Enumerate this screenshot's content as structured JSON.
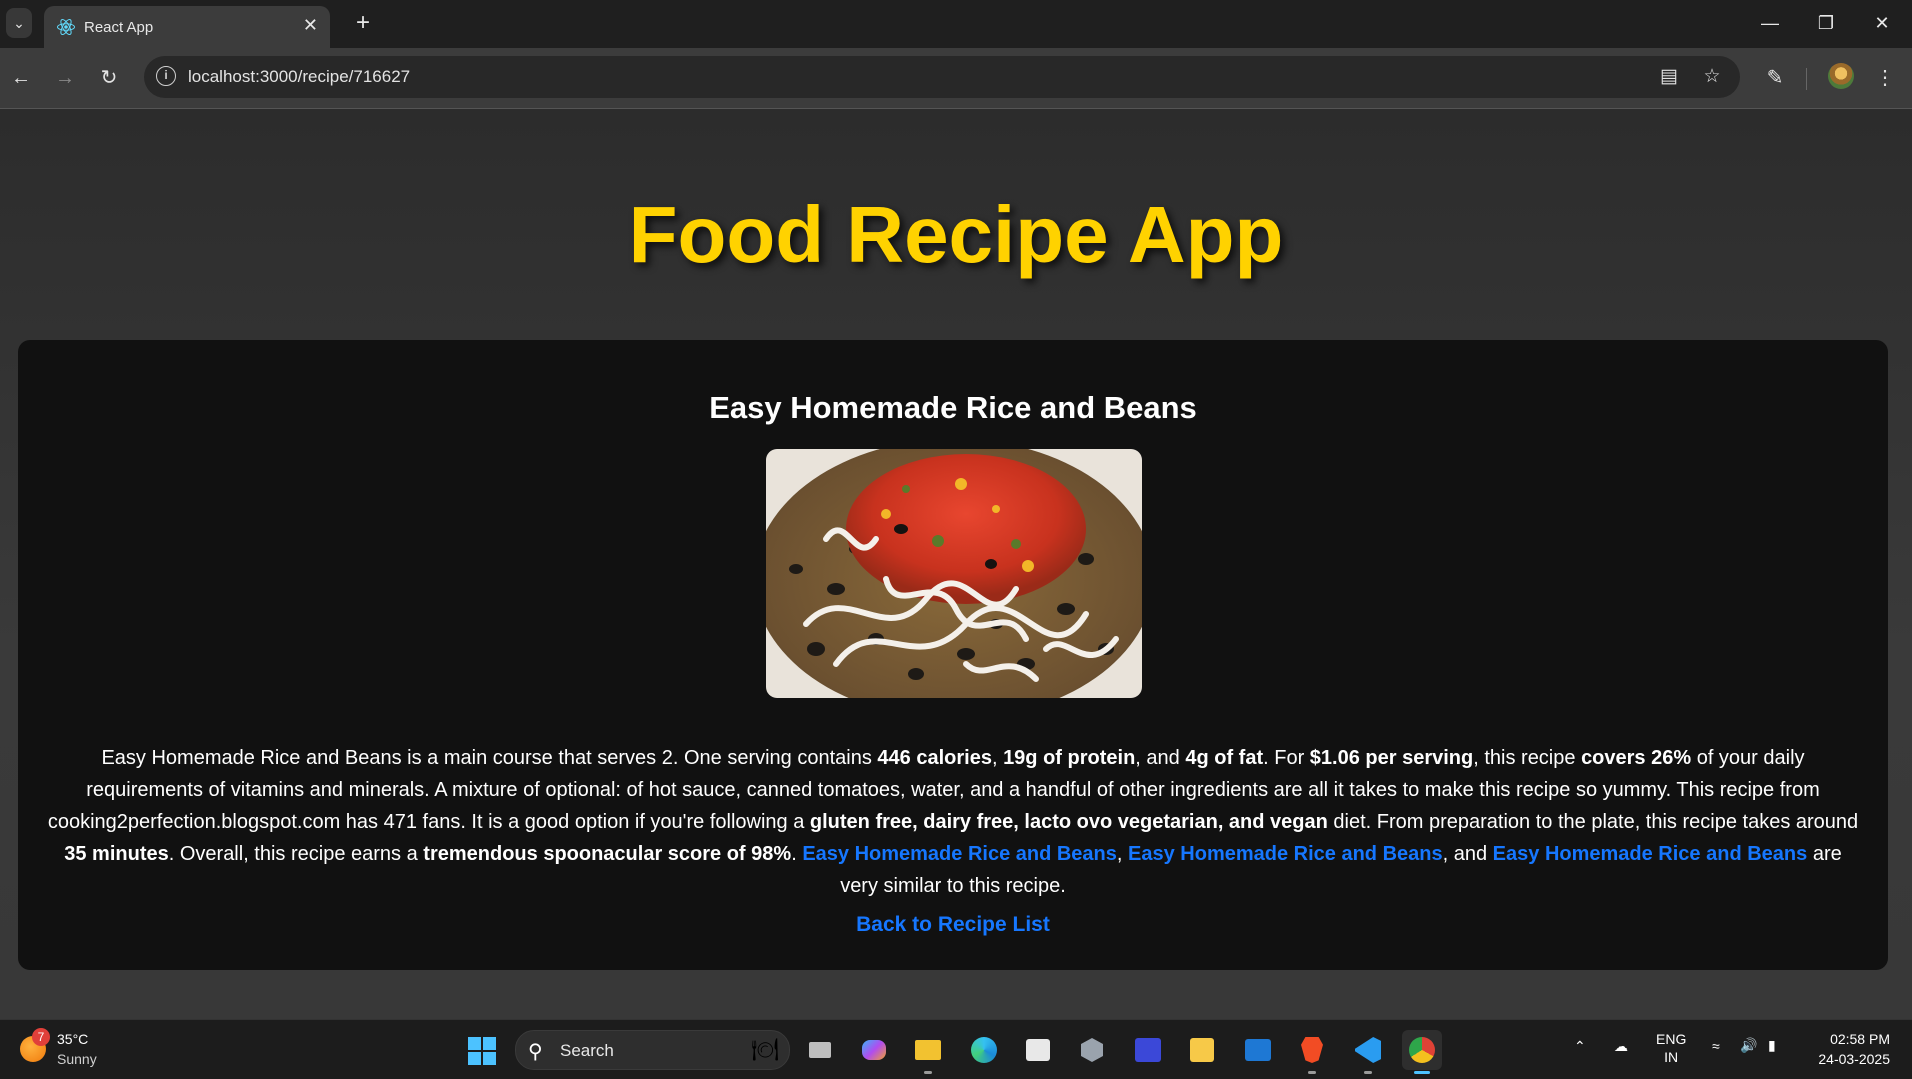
{
  "browser": {
    "tab_title": "React App",
    "url": "localhost:3000/recipe/716627"
  },
  "page": {
    "app_title": "Food Recipe App",
    "recipe": {
      "title": "Easy Homemade Rice and Beans",
      "image_alt": "Easy Homemade Rice and Beans",
      "summary": {
        "t1": "Easy Homemade Rice and Beans is a main course that serves 2. One serving contains ",
        "b1": "446 calories",
        "t2": ", ",
        "b2": "19g of protein",
        "t3": ", and ",
        "b3": "4g of fat",
        "t4": ". For ",
        "b4": "$1.06 per serving",
        "t5": ", this recipe ",
        "b5": "covers 26%",
        "t6": " of your daily requirements of vitamins and minerals. A mixture of optional: of hot sauce, canned tomatoes, water, and a handful of other ingredients are all it takes to make this recipe so yummy. This recipe from cooking2perfection.blogspot.com has 471 fans. It is a good option if you're following a ",
        "b6": "gluten free, dairy free, lacto ovo vegetarian, and vegan",
        "t7": " diet. From preparation to the plate, this recipe takes around ",
        "b7": "35 minutes",
        "t8": ". Overall, this recipe earns a ",
        "b8": "tremendous spoonacular score of 98%",
        "t9": ". ",
        "link1": "Easy Homemade Rice and Beans",
        "t10": ", ",
        "link2": "Easy Homemade Rice and Beans",
        "t11": ", and ",
        "link3": "Easy Homemade Rice and Beans",
        "t12": " are very similar to this recipe."
      },
      "back_link": "Back to Recipe List"
    },
    "colors": {
      "title_yellow": "#ffd200",
      "link_blue": "#1677ff",
      "card_bg": "#111111"
    }
  },
  "taskbar": {
    "weather_badge": "7",
    "weather_temp": "35°C",
    "weather_desc": "Sunny",
    "search_label": "Search",
    "lang_top": "ENG",
    "lang_bottom": "IN",
    "time": "02:58 PM",
    "date": "24-03-2025",
    "apps": [
      "task-view-icon",
      "copilot-icon",
      "file-explorer-icon",
      "edge-icon",
      "store-icon",
      "app-icon",
      "notes-icon",
      "sticky-notes-icon",
      "outlook-icon",
      "brave-icon",
      "vscode-icon",
      "chrome-icon"
    ]
  }
}
